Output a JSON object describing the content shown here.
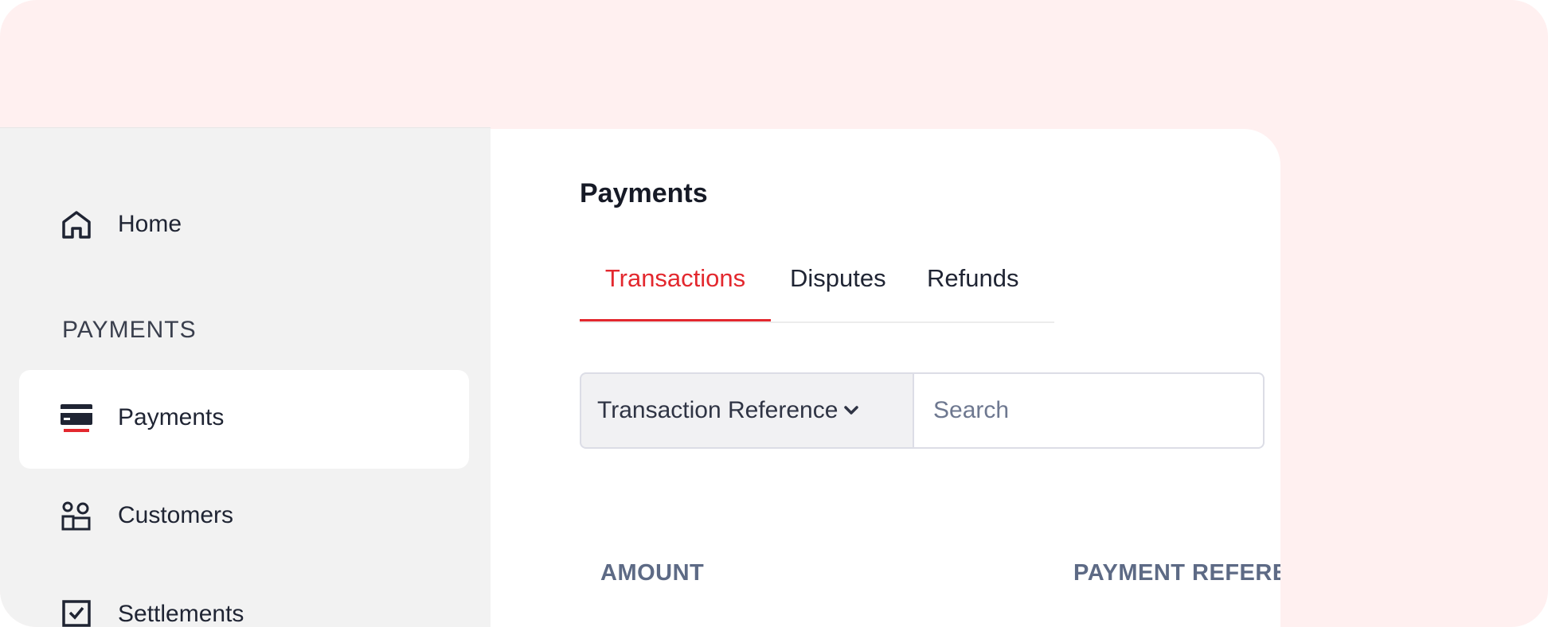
{
  "sidebar": {
    "home_label": "Home",
    "section_label": "PAYMENTS",
    "items": [
      {
        "label": "Payments",
        "icon": "card-icon",
        "active": true
      },
      {
        "label": "Customers",
        "icon": "customers-icon"
      },
      {
        "label": "Settlements",
        "icon": "settlements-icon"
      }
    ]
  },
  "main": {
    "title": "Payments",
    "tabs": [
      {
        "label": "Transactions",
        "active": true
      },
      {
        "label": "Disputes"
      },
      {
        "label": "Refunds"
      }
    ],
    "filter": {
      "select_value": "Transaction Reference",
      "search_placeholder": "Search"
    },
    "table": {
      "columns": [
        "AMOUNT",
        "PAYMENT REFERENCE"
      ]
    }
  },
  "colors": {
    "accent": "#e3282e",
    "background": "#fff0f0",
    "sidebar": "#f2f2f2"
  }
}
